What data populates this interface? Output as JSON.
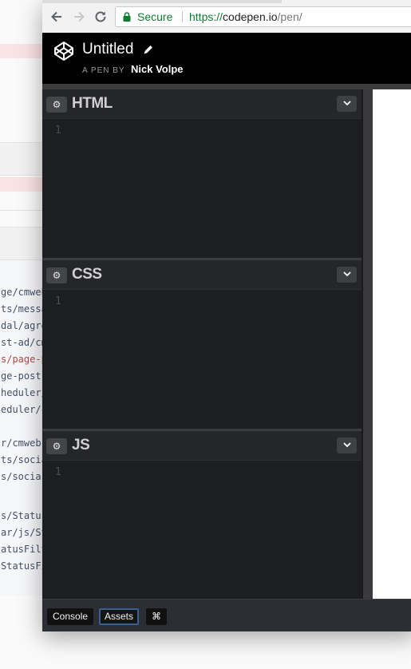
{
  "background": {
    "code_lines": [
      "ge/cmweb",
      "ts/messa",
      "dal/agre",
      "st-ad/cm",
      "s/page-p",
      "ge-post-",
      "heduler/",
      "eduler/c",
      "",
      "r/cmweb.",
      "ts/socia",
      "s/socia",
      "",
      "s/Status",
      "ar/js/St",
      "atusFilt",
      "StatusFi"
    ]
  },
  "browser": {
    "secure_label": "Secure",
    "url_scheme": "https://",
    "url_host": "codepen.io",
    "url_path": "/pen/"
  },
  "codepen": {
    "title": "Untitled",
    "byline_prefix": "A PEN BY",
    "author": "Nick Volpe",
    "editors": [
      {
        "title": "HTML",
        "line": "1"
      },
      {
        "title": "CSS",
        "line": "1"
      },
      {
        "title": "JS",
        "line": "1"
      }
    ],
    "footer": {
      "console": "Console",
      "assets": "Assets",
      "shortcuts": "⌘"
    }
  },
  "colors": {
    "secure_green": "#0f7b32",
    "editor_bg": "#1d1e22",
    "header_bg": "#000000"
  },
  "icons": [
    "back-arrow-icon",
    "forward-arrow-icon",
    "reload-icon",
    "lock-icon",
    "codepen-logo",
    "pencil-icon",
    "gear-icon",
    "chevron-down-icon"
  ]
}
